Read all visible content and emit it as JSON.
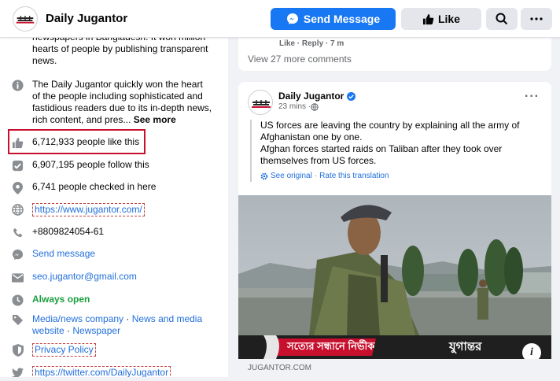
{
  "header": {
    "page_name": "Daily Jugantor",
    "send_message_label": "Send Message",
    "like_label": "Like"
  },
  "about": {
    "intro_tail": "newspapers in Bangladesh. It won million hearts of people by publishing transparent news.",
    "description": "The Daily Jugantor quickly won the heart of the people including sophisticated and fastidious readers due to its in-depth news, rich content, and pres...",
    "see_more": "See more",
    "likes": "6,712,933 people like this",
    "follows": "6,907,195 people follow this",
    "checkins": "6,741 people checked in here",
    "website": "https://www.jugantor.com/",
    "phone": "+8809824054-61",
    "send_message": "Send message",
    "email": "seo.jugantor@gmail.com",
    "hours": "Always open",
    "categories": [
      "Media/news company",
      "News and media website",
      "Newspaper"
    ],
    "privacy": "Privacy Policy",
    "twitter": "https://twitter.com/DailyJugantor"
  },
  "feed": {
    "comment_actions": "Like · Reply · 7 m",
    "view_more_comments": "View 27 more comments",
    "post": {
      "author": "Daily Jugantor",
      "time": "23 mins · ",
      "text_line1": "US forces are leaving the country by explaining all the army of Afghanistan one by one.",
      "text_line2": "Afghan forces started raids on Taliban after they took over themselves from US forces.",
      "see_original": "See original",
      "rate_translation": "Rate this translation",
      "banner_text": "সত্যের সন্ধানে নির্ভীক",
      "banner_logo": "যুগান্তর",
      "source": "JUGANTOR.COM"
    }
  },
  "colors": {
    "accent": "#1877f2",
    "highlight_box": "#c8102e",
    "banner_red": "#c8102e"
  }
}
